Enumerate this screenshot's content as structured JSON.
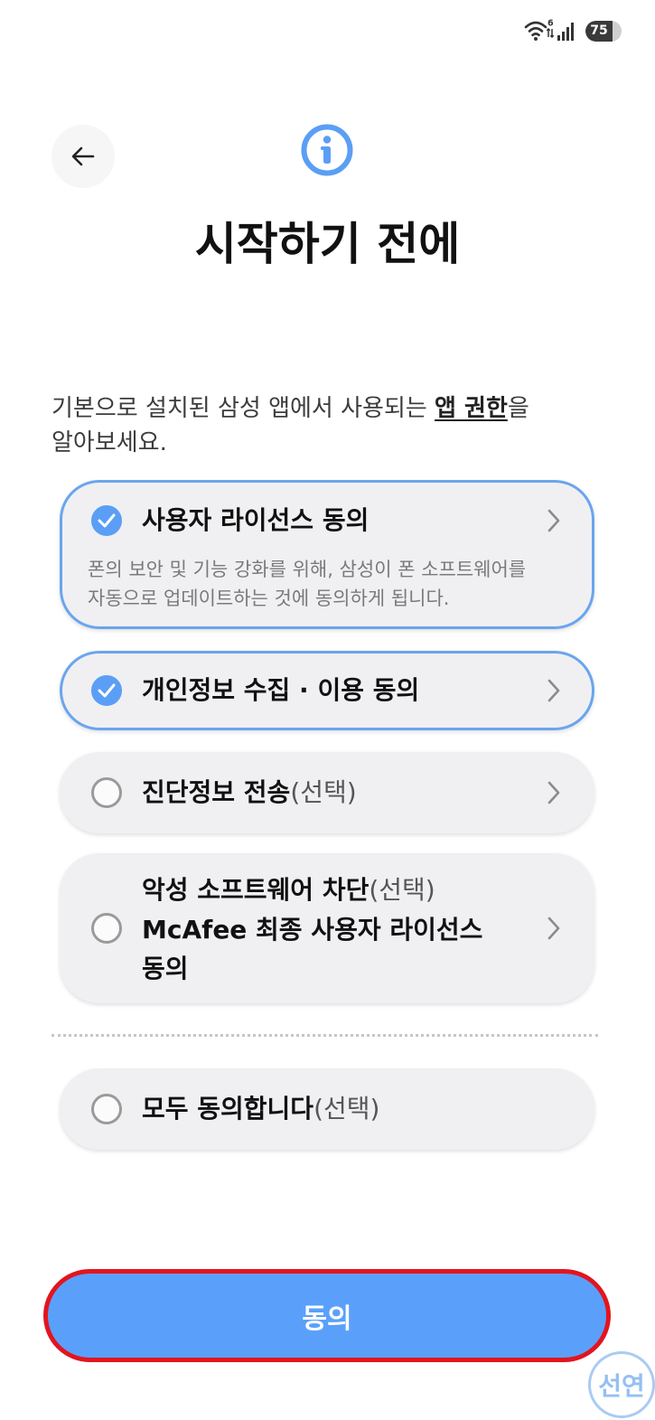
{
  "status_bar": {
    "wifi_icon": "wifi-icon",
    "wifi_badge": "6",
    "signal_icon": "cellular-signal-icon",
    "battery_level": "75"
  },
  "nav": {
    "back_icon": "arrow-left-icon"
  },
  "header": {
    "icon": "info-icon",
    "title": "시작하기 전에"
  },
  "intro": {
    "text": "기본으로 설치된 삼성 앱에서 사용되는 ",
    "link": "앱 권한",
    "suffix": "을",
    "line2": "알아보세요."
  },
  "agreements": [
    {
      "label": "사용자 라이선스 동의",
      "checked": true,
      "description_lines": [
        "폰의 보안 및 기능 강화를 위해, 삼성이 폰 소프트웨어를",
        "자동으로 업데이트하는 것에 동의하게 됩니다."
      ]
    },
    {
      "label": "개인정보 수집 · 이용 동의",
      "checked": true
    },
    {
      "label": "진단정보 전송",
      "optional": "(선택)",
      "checked": false
    },
    {
      "label": "악성 소프트웨어 차단",
      "optional": "(선택)",
      "sub_lines": [
        "McAfee 최종 사용자 라이선스",
        "동의"
      ],
      "checked": false
    }
  ],
  "agree_all": {
    "label": "모두 동의합니다",
    "optional": "(선택)",
    "checked": false
  },
  "footer": {
    "button_label": "동의"
  },
  "watermark": {
    "text": "선연"
  },
  "colors": {
    "accent": "#5b9ef5",
    "button": "#5aa0fb",
    "highlight_ring": "#e3141e",
    "selected_border": "#6aa5ee"
  }
}
